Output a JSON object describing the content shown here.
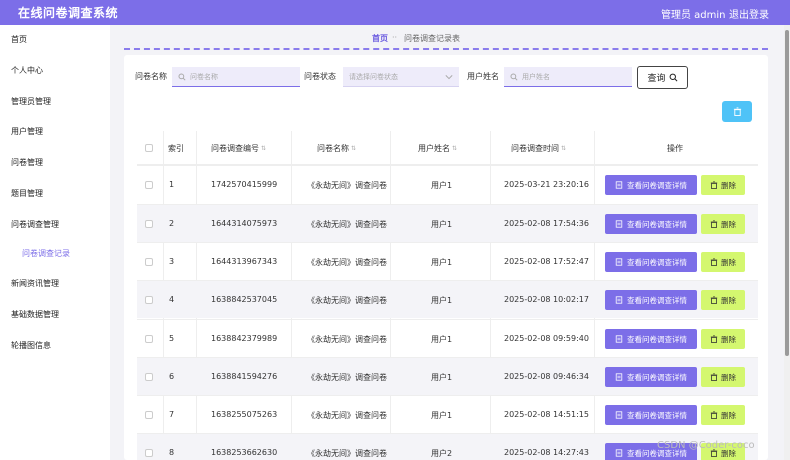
{
  "header": {
    "title": "在线问卷调查系统",
    "user": "管理员 admin",
    "logout": "退出登录"
  },
  "sidebar": {
    "items": [
      {
        "label": "首页"
      },
      {
        "label": "个人中心"
      },
      {
        "label": "管理员管理"
      },
      {
        "label": "用户管理"
      },
      {
        "label": "问卷管理"
      },
      {
        "label": "题目管理"
      },
      {
        "label": "问卷调查管理"
      },
      {
        "label": "问卷调查记录"
      },
      {
        "label": "新闻资讯管理"
      },
      {
        "label": "基础数据管理"
      },
      {
        "label": "轮播图信息"
      }
    ]
  },
  "breadcrumb": {
    "home": "首页",
    "sep": "··",
    "current": "问卷调查记录表"
  },
  "filters": {
    "name_label": "问卷名称",
    "name_placeholder": "问卷名称",
    "status_label": "问卷状态",
    "status_placeholder": "请选择问卷状态",
    "user_label": "用户姓名",
    "user_placeholder": "用户姓名",
    "search": "查询"
  },
  "table": {
    "headers": [
      "索引",
      "问卷调查编号",
      "问卷名称",
      "用户姓名",
      "问卷调查时间",
      "操作"
    ],
    "detail_label": "查看问卷调查详情",
    "delete_label": "删除",
    "rows": [
      {
        "idx": "1",
        "code": "1742570415999",
        "name": "《永劫无间》调查问卷",
        "user": "用户1",
        "time": "2025-03-21 23:20:16"
      },
      {
        "idx": "2",
        "code": "1644314075973",
        "name": "《永劫无间》调查问卷",
        "user": "用户1",
        "time": "2025-02-08 17:54:36"
      },
      {
        "idx": "3",
        "code": "1644313967343",
        "name": "《永劫无间》调查问卷",
        "user": "用户1",
        "time": "2025-02-08 17:52:47"
      },
      {
        "idx": "4",
        "code": "1638842537045",
        "name": "《永劫无间》调查问卷",
        "user": "用户1",
        "time": "2025-02-08 10:02:17"
      },
      {
        "idx": "5",
        "code": "1638842379989",
        "name": "《永劫无间》调查问卷",
        "user": "用户1",
        "time": "2025-02-08 09:59:40"
      },
      {
        "idx": "6",
        "code": "1638841594276",
        "name": "《永劫无间》调查问卷",
        "user": "用户1",
        "time": "2025-02-08 09:46:34"
      },
      {
        "idx": "7",
        "code": "1638255075263",
        "name": "《永劫无间》调查问卷",
        "user": "用户1",
        "time": "2025-02-08 14:51:15"
      },
      {
        "idx": "8",
        "code": "1638253662630",
        "name": "《永劫无间》调查问卷",
        "user": "用户2",
        "time": "2025-02-08 14:27:43"
      }
    ]
  },
  "watermark": "CSDN @Coder-coco",
  "colors": {
    "accent": "#7c6ee8",
    "delete": "#d4f76f",
    "bulk_delete": "#4fc3f7"
  }
}
